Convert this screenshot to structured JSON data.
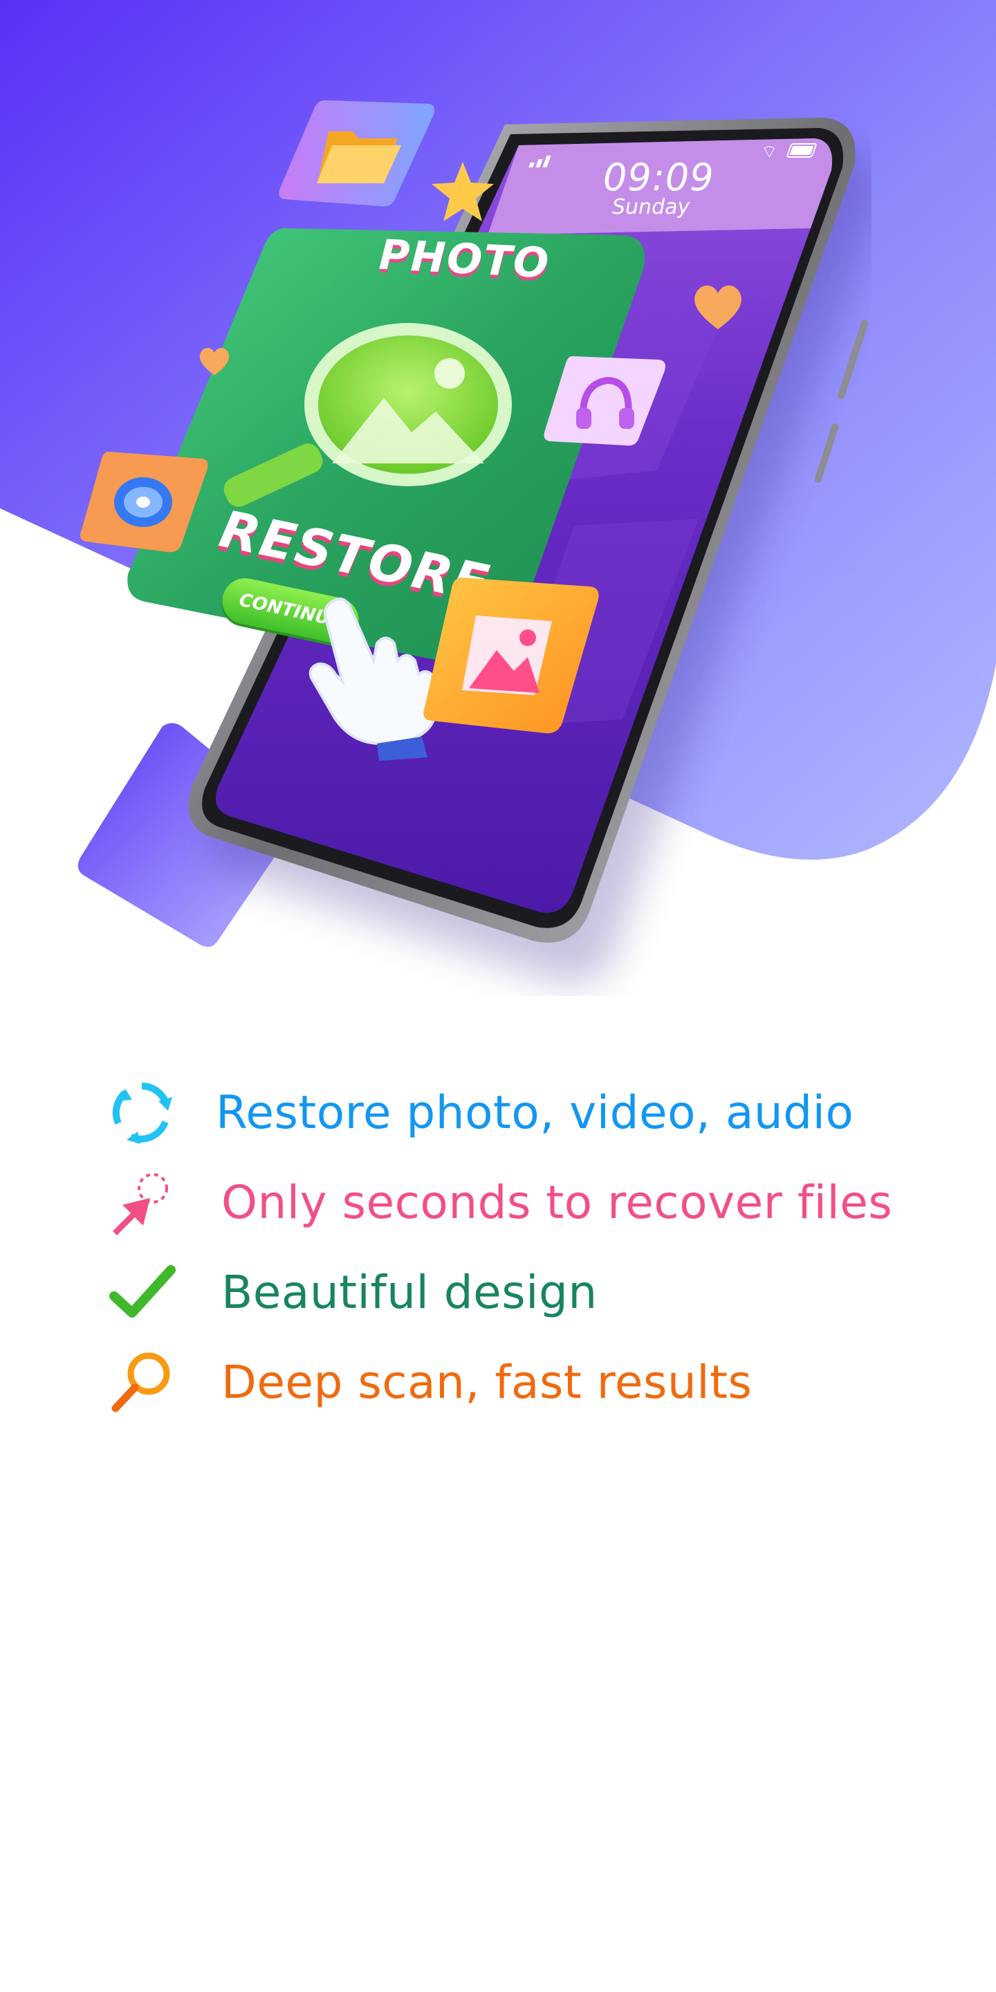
{
  "colors": {
    "bg_gradient_start": "#5b2ff7",
    "bg_gradient_end": "#aab2ff",
    "phone_screen": "#5b22b8",
    "card_green": "#2aa45f",
    "feature_blue": "#1297f2",
    "feature_pink": "#f24f86",
    "feature_green": "#18855d",
    "feature_orange": "#f06a0f"
  },
  "phone": {
    "time": "09:09",
    "day": "Sunday"
  },
  "card": {
    "title": "PHOTO",
    "headline": "RESTORE",
    "button": "CONTINUE"
  },
  "icons": {
    "folder": "folder-icon",
    "star": "star-icon",
    "heart": "heart-icon",
    "headphones": "headphones-icon",
    "disc": "disc-icon",
    "gallery": "image-icon",
    "hand": "pointing-hand-icon",
    "magnifier": "magnifier-icon"
  },
  "features": [
    {
      "text": "Restore photo, video, audio",
      "icon": "refresh-icon"
    },
    {
      "text": "Only seconds to recover files",
      "icon": "cursor-click-icon"
    },
    {
      "text": "Beautiful design",
      "icon": "checkmark-icon"
    },
    {
      "text": "Deep scan, fast results",
      "icon": "search-icon"
    }
  ]
}
